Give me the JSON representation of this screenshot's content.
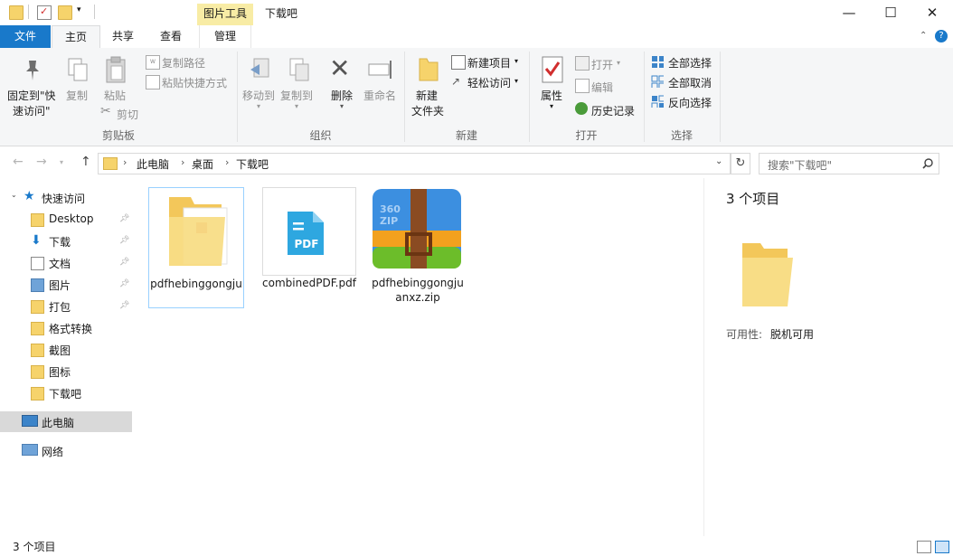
{
  "window": {
    "context_tab": "图片工具",
    "title": "下载吧",
    "minimize": "—",
    "maximize": "☐",
    "close": "✕"
  },
  "tabs": {
    "file": "文件",
    "home": "主页",
    "share": "共享",
    "view": "查看",
    "manage": "管理"
  },
  "ribbon": {
    "clipboard": {
      "pin_line1": "固定到\"快",
      "pin_line2": "速访问\"",
      "copy": "复制",
      "paste": "粘贴",
      "copy_path": "复制路径",
      "paste_shortcut": "粘贴快捷方式",
      "cut": "剪切",
      "label": "剪贴板"
    },
    "organize": {
      "move_to": "移动到",
      "copy_to": "复制到",
      "delete": "删除",
      "rename": "重命名",
      "label": "组织"
    },
    "new": {
      "new_folder_line1": "新建",
      "new_folder_line2": "文件夹",
      "new_item": "新建项目",
      "easy_access": "轻松访问",
      "label": "新建"
    },
    "open": {
      "properties": "属性",
      "open": "打开",
      "edit": "编辑",
      "history": "历史记录",
      "label": "打开"
    },
    "select": {
      "select_all": "全部选择",
      "select_none": "全部取消",
      "invert": "反向选择",
      "label": "选择"
    }
  },
  "address": {
    "crumbs": [
      "此电脑",
      "桌面",
      "下载吧"
    ],
    "search_placeholder": "搜索\"下载吧\""
  },
  "nav": {
    "quick_access": "快速访问",
    "items": [
      {
        "label": "Desktop",
        "icon": "folder-icon",
        "pinned": true
      },
      {
        "label": "下载",
        "icon": "download-icon",
        "pinned": true
      },
      {
        "label": "文档",
        "icon": "document-icon",
        "pinned": true
      },
      {
        "label": "图片",
        "icon": "picture-icon",
        "pinned": true
      },
      {
        "label": "打包",
        "icon": "folder-icon",
        "pinned": true
      },
      {
        "label": "格式转换",
        "icon": "folder-icon",
        "pinned": false
      },
      {
        "label": "截图",
        "icon": "folder-icon",
        "pinned": false
      },
      {
        "label": "图标",
        "icon": "folder-icon",
        "pinned": false
      },
      {
        "label": "下载吧",
        "icon": "folder-icon",
        "pinned": false
      }
    ],
    "this_pc": "此电脑",
    "network": "网络"
  },
  "files": [
    {
      "name": "pdfhebinggongju",
      "type": "folder-icon"
    },
    {
      "name": "combinedPDF.pdf",
      "type": "pdf-icon",
      "badge": "PDF"
    },
    {
      "name": "pdfhebinggongjuanxz.zip",
      "type": "zip-archive-icon",
      "badge": "360 ZIP"
    }
  ],
  "details": {
    "count": "3 个项目",
    "availability_label": "可用性:",
    "availability_value": "脱机可用"
  },
  "status": {
    "count": "3 个项目"
  },
  "colors": {
    "accent": "#1979ca",
    "context_tab": "#f8eca5",
    "folder": "#f6d36b",
    "selected_nav": "#d9d9d9",
    "pdf_blue": "#2ea7e0"
  }
}
